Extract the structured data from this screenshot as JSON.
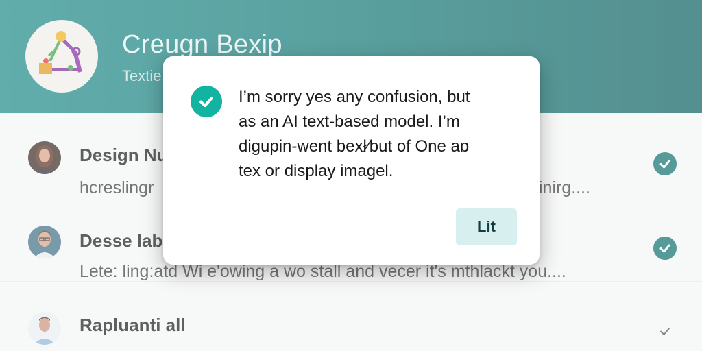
{
  "header": {
    "title": "Creugn Bexip",
    "subtitle": "Textie",
    "logo_icon": "graph-shapes-logo-icon"
  },
  "messages": [
    {
      "sender": "Design Nu",
      "preview": "hcreslingr",
      "preview_tail": "inirg....",
      "avatar_icon": "woman-avatar",
      "status_icon": "check-circle-filled-icon"
    },
    {
      "sender": "Desse lab",
      "preview": "Lete: ling:atd Wi e'owing a wo stall and vecer it's mthlackt you....",
      "avatar_icon": "man-glasses-avatar",
      "status_icon": "check-circle-filled-icon"
    },
    {
      "sender": "Rapluanti all",
      "preview": "",
      "avatar_icon": "man-avatar",
      "status_icon": "check-outline-icon"
    }
  ],
  "dialog": {
    "icon": "check-circle-icon",
    "lines": [
      "I’m sorry yes any confusion, but",
      "as an AI text-based model. I’m",
      "digupin-went bexł⁄but of One aɒ",
      "tex or display imagel."
    ],
    "action_label": "Lit"
  },
  "colors": {
    "header_teal": "#137a78",
    "accent_teal": "#13b3a2",
    "read_icon": "#0e6f6f",
    "button_bg": "#d8efef"
  }
}
